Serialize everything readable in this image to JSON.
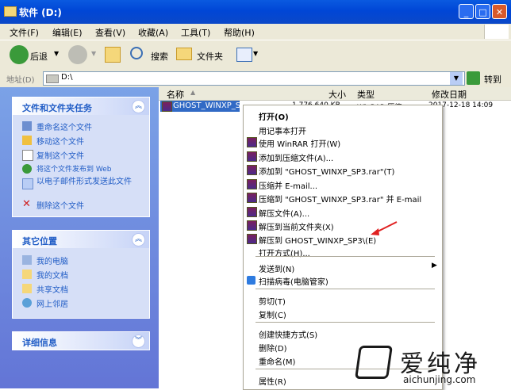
{
  "window": {
    "title": "软件 (D:)"
  },
  "menubar": [
    "文件(F)",
    "编辑(E)",
    "查看(V)",
    "收藏(A)",
    "工具(T)",
    "帮助(H)"
  ],
  "toolbar": {
    "back": "后退",
    "search": "搜索",
    "folders": "文件夹"
  },
  "address": {
    "label": "地址(D)",
    "value": "D:\\",
    "go": "转到"
  },
  "left_panels": {
    "tasks": {
      "title": "文件和文件夹任务",
      "items": [
        "重命名这个文件",
        "移动这个文件",
        "复制这个文件",
        "将这个文件发布到 Web",
        "以电子邮件形式发送此文件",
        "删除这个文件"
      ]
    },
    "places": {
      "title": "其它位置",
      "items": [
        "我的电脑",
        "我的文档",
        "共享文档",
        "网上邻居"
      ]
    },
    "details": {
      "title": "详细信息"
    }
  },
  "columns": [
    "名称",
    "大小",
    "类型",
    "修改日期"
  ],
  "file": {
    "name": "GHOST_WINXP_SP3",
    "size": "1,776,640 KB",
    "type": "WinRAR 压缩",
    "date": "2017-12-18 14:09"
  },
  "context_menu": [
    "打开(O)",
    "用记事本打开",
    "使用 WinRAR 打开(W)",
    "添加到压缩文件(A)...",
    "添加到 \"GHOST_WINXP_SP3.rar\"(T)",
    "压缩并 E-mail...",
    "压缩到 \"GHOST_WINXP_SP3.rar\" 并 E-mail",
    "解压文件(A)...",
    "解压到当前文件夹(X)",
    "解压到 GHOST_WINXP_SP3\\(E)",
    "打开方式(H)...",
    "发送到(N)",
    "扫描病毒(电脑管家)",
    "剪切(T)",
    "复制(C)",
    "创建快捷方式(S)",
    "删除(D)",
    "重命名(M)",
    "属性(R)"
  ],
  "watermark": {
    "brand": "爱纯净",
    "url": "aichunjing.com"
  },
  "colors": {
    "accent": "#0a5ae0",
    "selection": "#316ac5",
    "task_text": "#215dc6",
    "arrow": "#e02020"
  }
}
